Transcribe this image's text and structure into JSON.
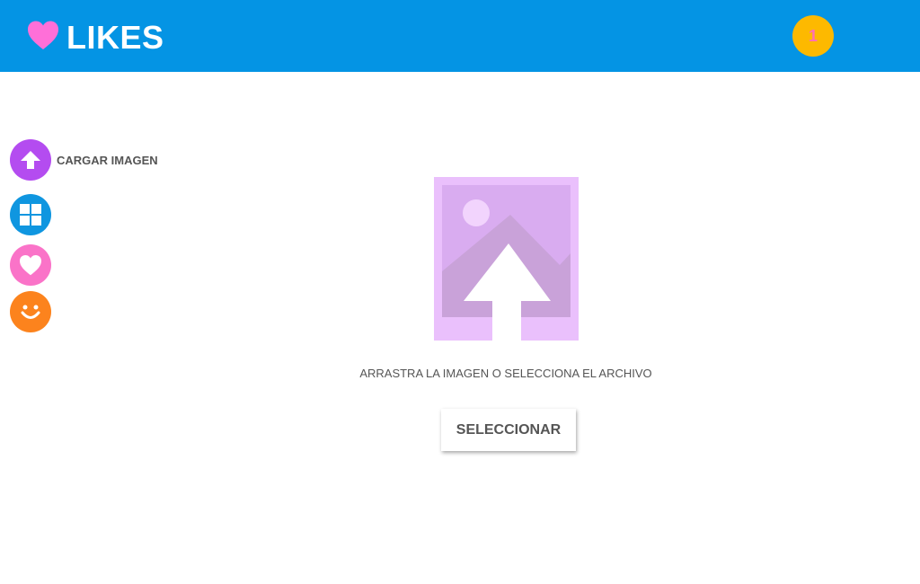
{
  "header": {
    "title": "LIKES",
    "notification_count": "1",
    "background_color": "#0494e4",
    "logo_icon": "heart-icon"
  },
  "sidebar": {
    "items": [
      {
        "label": "CARGAR IMAGEN",
        "icon": "upload-arrow-icon",
        "color": "#b44cf0"
      },
      {
        "label": "",
        "icon": "grid-icon",
        "color": "#0f96e0"
      },
      {
        "label": "",
        "icon": "heart-icon",
        "color": "#fa73c8"
      },
      {
        "label": "",
        "icon": "smile-icon",
        "color": "#fc831d"
      }
    ]
  },
  "upload": {
    "illustration_icon": "image-upload-icon",
    "instructions": "ARRASTRA LA IMAGEN O SELECCIONA EL ARCHIVO",
    "button_label": "SELECCIONAR"
  }
}
